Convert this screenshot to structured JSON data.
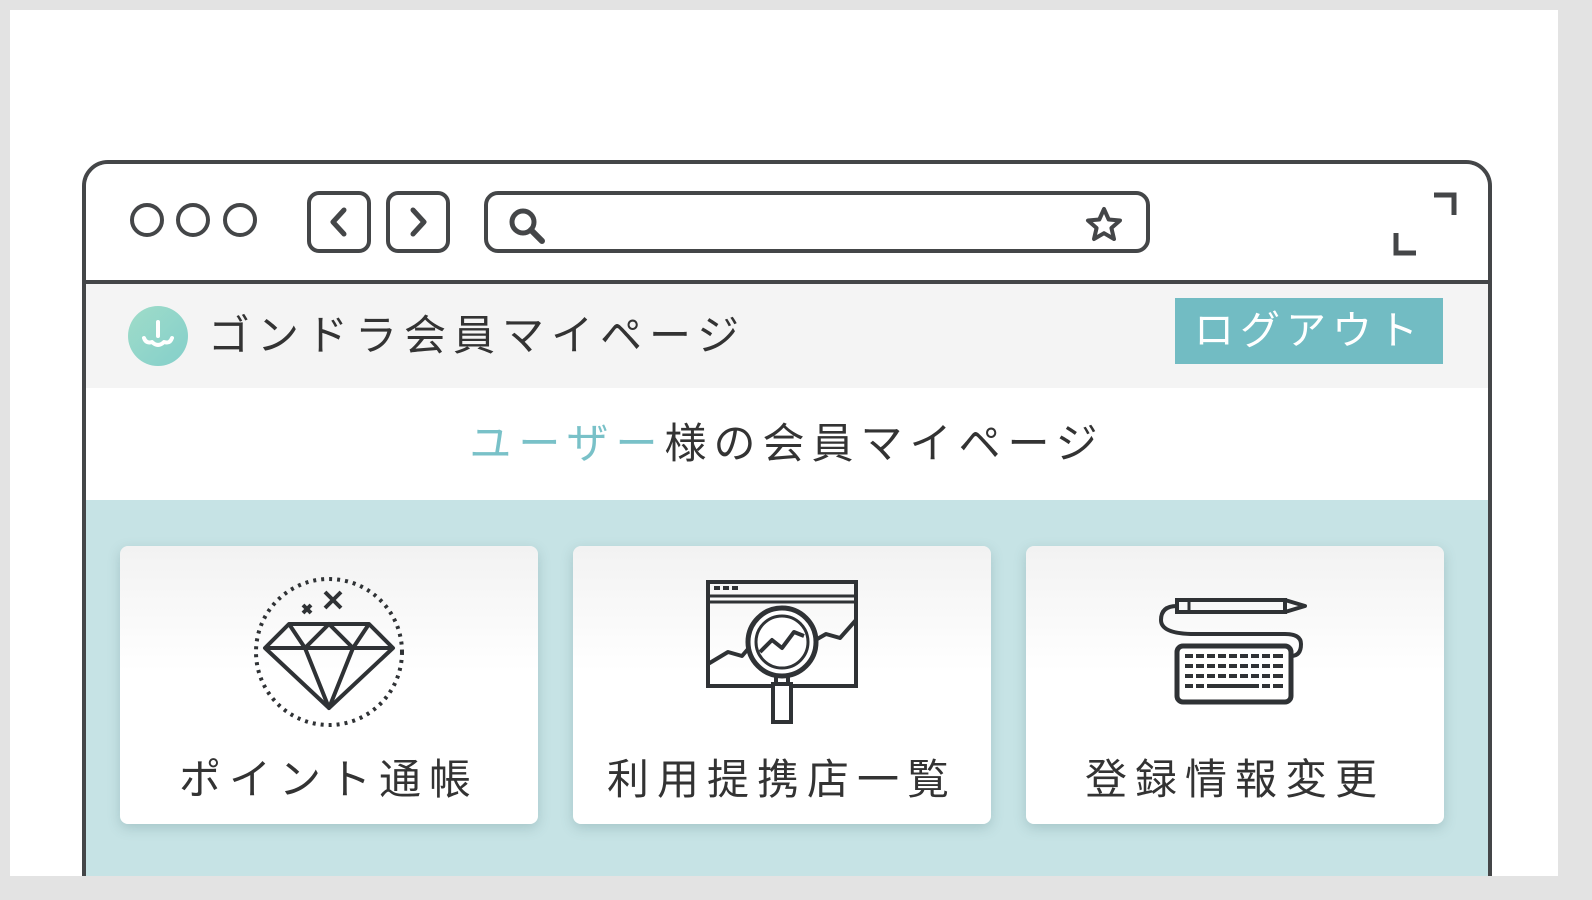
{
  "site": {
    "title": "ゴンドラ会員マイページ",
    "logout_label": "ログアウト"
  },
  "welcome": {
    "user_name": "ユーザー",
    "suffix": "様の会員マイページ"
  },
  "menu": [
    {
      "label": "ポイント通帳",
      "icon": "diamond-icon"
    },
    {
      "label": "利用提携店一覧",
      "icon": "analytics-search-icon"
    },
    {
      "label": "登録情報変更",
      "icon": "keyboard-pen-icon"
    }
  ],
  "colors": {
    "accent": "#72bcc3",
    "content_bg": "#c6e3e5",
    "header_bg": "#f4f4f4",
    "frame": "#444648",
    "user_name": "#79c1c8"
  }
}
